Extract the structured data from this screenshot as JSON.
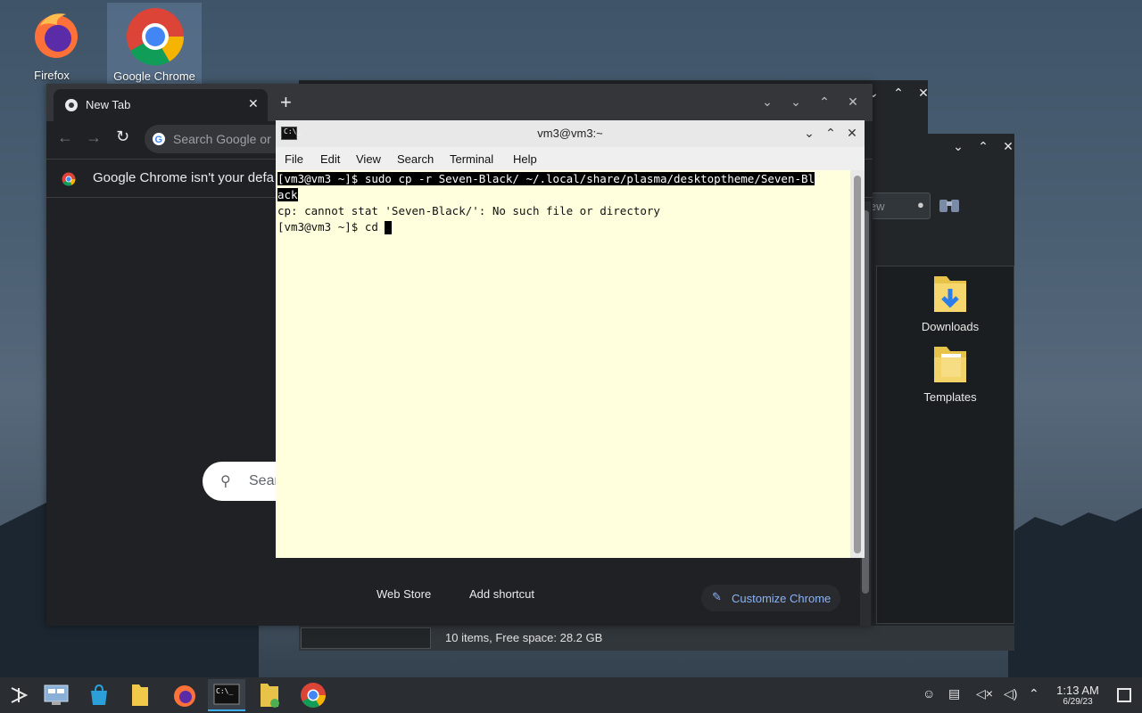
{
  "desktop": {
    "icons": [
      {
        "label": "Firefox"
      },
      {
        "label": "Google Chrome"
      }
    ]
  },
  "chrome": {
    "tab_title": "New Tab",
    "new_tab": "+",
    "omnibox_placeholder": "Search Google or",
    "infobar_text": "Google Chrome isn't your defa",
    "search_box_placeholder": "Sear",
    "shortcuts": [
      {
        "label": "Web Store"
      },
      {
        "label": "Add shortcut"
      }
    ],
    "customize_label": "Customize Chrome"
  },
  "terminal": {
    "title": "vm3@vm3:~",
    "menu": [
      "File",
      "Edit",
      "View",
      "Search",
      "Terminal",
      "Help"
    ],
    "lines": {
      "l1_prompt": "[vm3@vm3 ~]$ ",
      "l1_cmd": "sudo cp -r Seven-Black/ ~/.local/share/plasma/desktoptheme/Seven-Bl",
      "l2": "ack",
      "l3": "cp: cannot stat 'Seven-Black/': No such file or directory",
      "l4_prompt": "[vm3@vm3 ~]$ ",
      "l4_cmd": "cd "
    }
  },
  "dolphin": {
    "search_hint": "iew",
    "folders": [
      {
        "label": "Downloads"
      },
      {
        "label": "Templates"
      }
    ],
    "status": "10 items, Free space: 28.2 GB"
  },
  "taskbar": {
    "time": "1:13 AM",
    "date": "6/29/23"
  },
  "colors": {
    "accent": "#3daee9",
    "terminal_bg": "#ffffdd",
    "chrome_bg": "#202124"
  }
}
